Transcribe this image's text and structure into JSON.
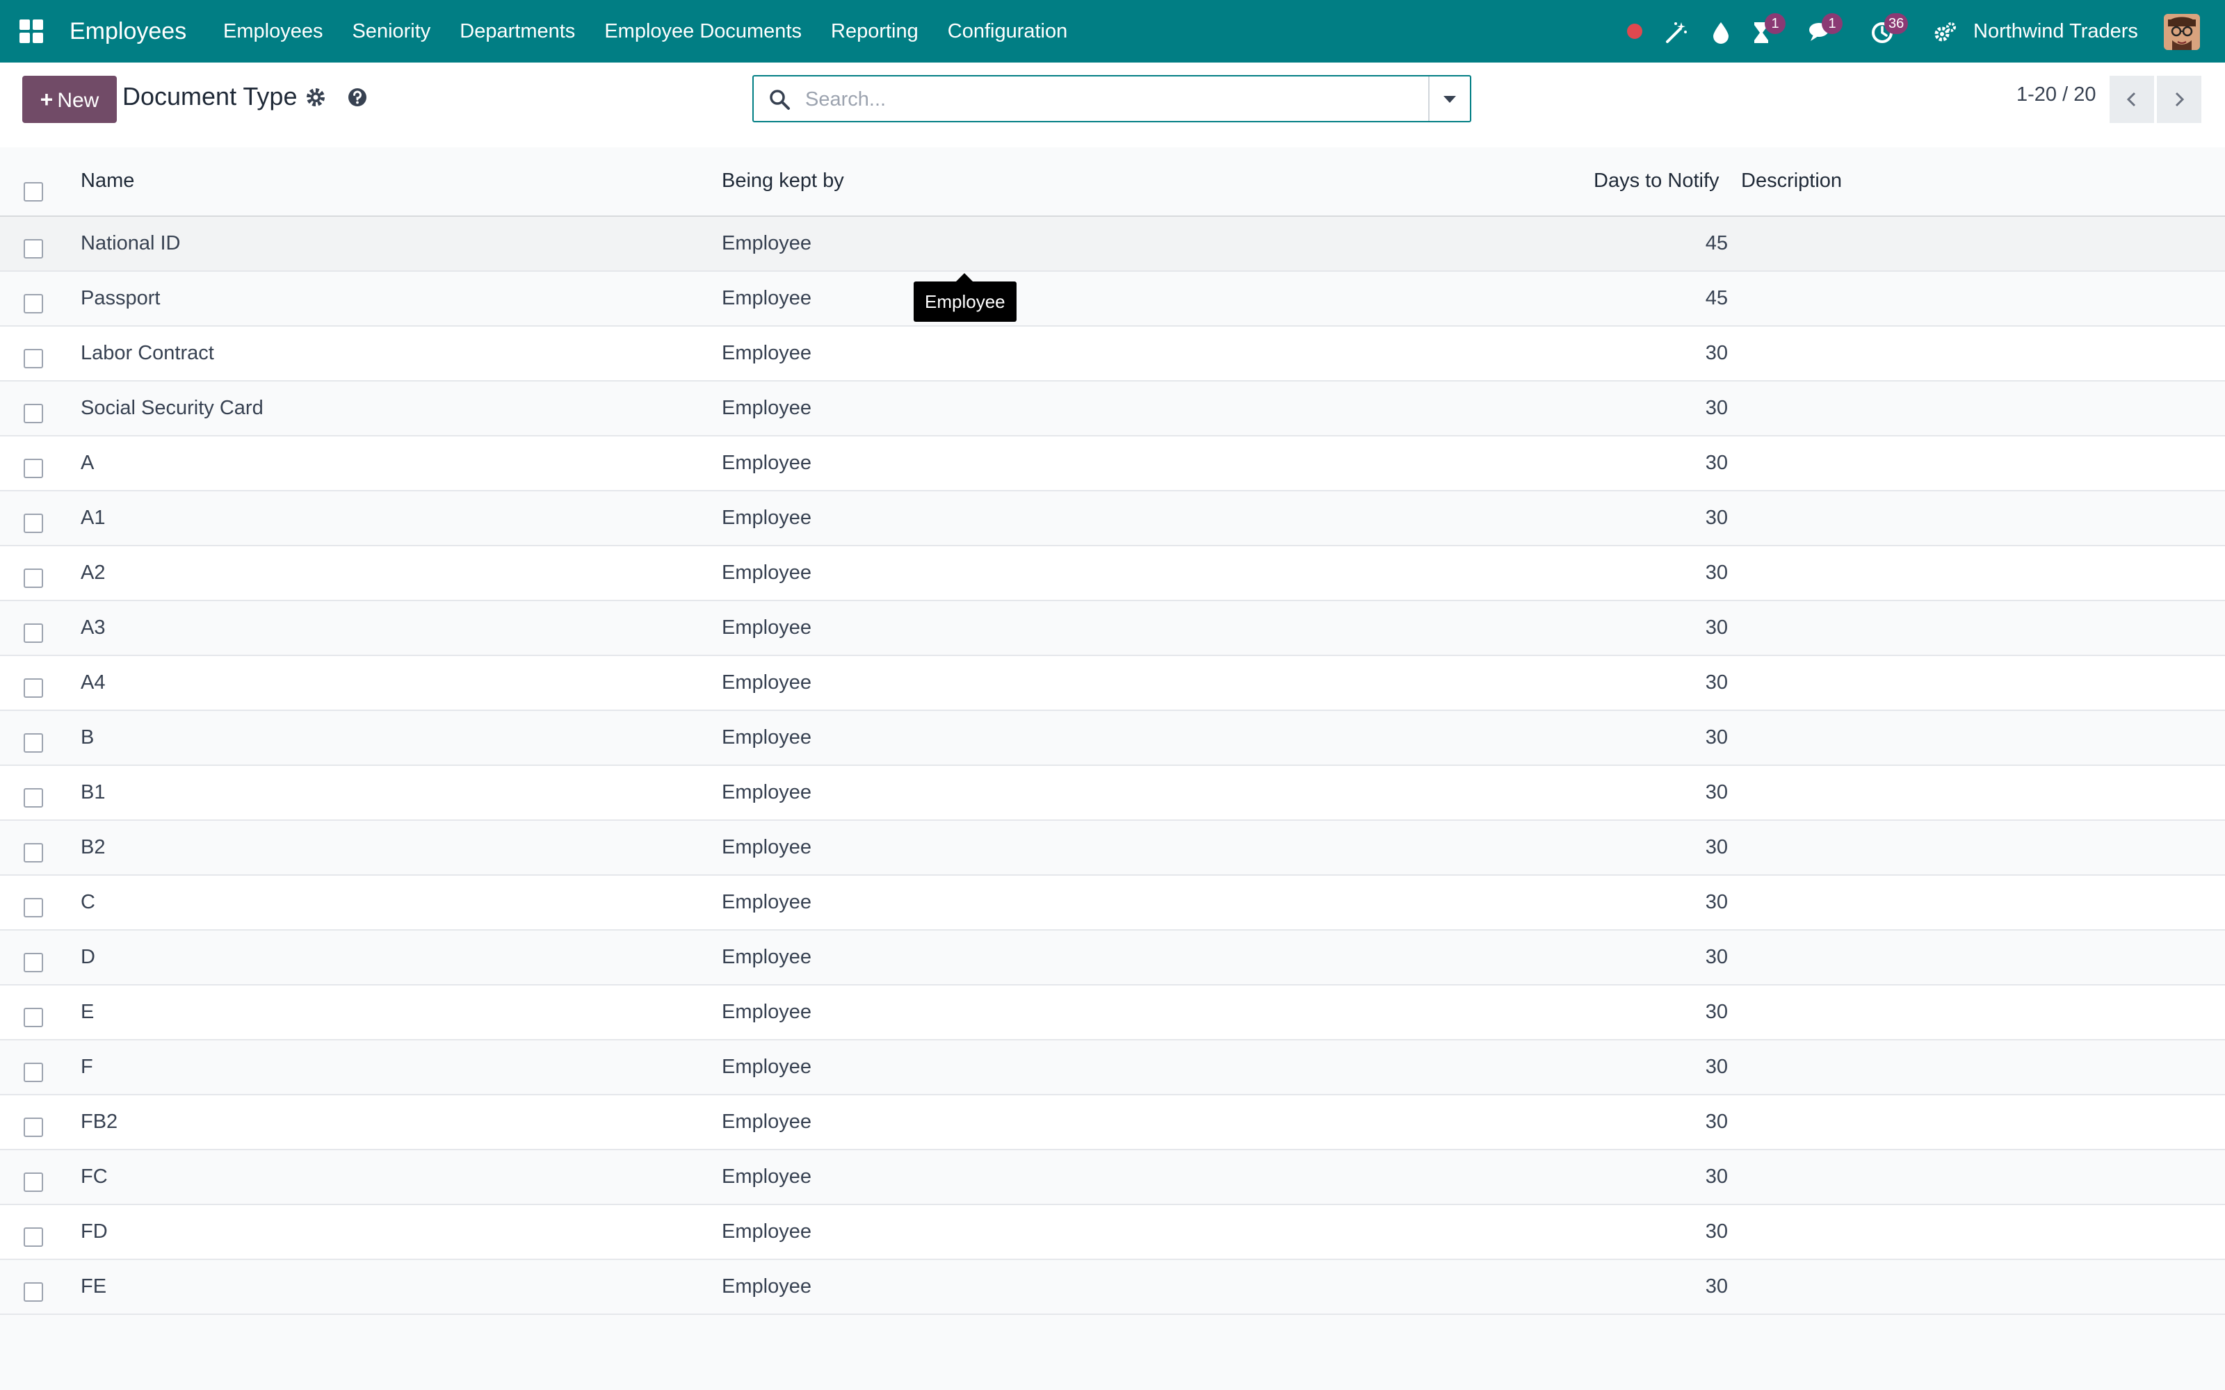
{
  "navbar": {
    "app_name": "Employees",
    "menu": [
      "Employees",
      "Seniority",
      "Departments",
      "Employee Documents",
      "Reporting",
      "Configuration"
    ],
    "systray": {
      "recording_icon": "red-dot-icon",
      "debug_icon": "magic-wand-icon",
      "drop_icon": "droplet-icon",
      "activity_badge": "1",
      "messages_badge": "1",
      "clock_badge": "36",
      "settings_icon": "gears-icon"
    },
    "company": "Northwind Traders"
  },
  "control_panel": {
    "new_label": "New",
    "title": "Document Type",
    "search_placeholder": "Search...",
    "pager": "1-20 / 20"
  },
  "table": {
    "columns": [
      "Name",
      "Being kept by",
      "Days to Notify",
      "Description"
    ],
    "rows": [
      {
        "name": "National ID",
        "kept_by": "Employee",
        "days": "45",
        "description": ""
      },
      {
        "name": "Passport",
        "kept_by": "Employee",
        "days": "45",
        "description": ""
      },
      {
        "name": "Labor Contract",
        "kept_by": "Employee",
        "days": "30",
        "description": ""
      },
      {
        "name": "Social Security Card",
        "kept_by": "Employee",
        "days": "30",
        "description": ""
      },
      {
        "name": "A",
        "kept_by": "Employee",
        "days": "30",
        "description": ""
      },
      {
        "name": "A1",
        "kept_by": "Employee",
        "days": "30",
        "description": ""
      },
      {
        "name": "A2",
        "kept_by": "Employee",
        "days": "30",
        "description": ""
      },
      {
        "name": "A3",
        "kept_by": "Employee",
        "days": "30",
        "description": ""
      },
      {
        "name": "A4",
        "kept_by": "Employee",
        "days": "30",
        "description": ""
      },
      {
        "name": "B",
        "kept_by": "Employee",
        "days": "30",
        "description": ""
      },
      {
        "name": "B1",
        "kept_by": "Employee",
        "days": "30",
        "description": ""
      },
      {
        "name": "B2",
        "kept_by": "Employee",
        "days": "30",
        "description": ""
      },
      {
        "name": "C",
        "kept_by": "Employee",
        "days": "30",
        "description": ""
      },
      {
        "name": "D",
        "kept_by": "Employee",
        "days": "30",
        "description": ""
      },
      {
        "name": "E",
        "kept_by": "Employee",
        "days": "30",
        "description": ""
      },
      {
        "name": "F",
        "kept_by": "Employee",
        "days": "30",
        "description": ""
      },
      {
        "name": "FB2",
        "kept_by": "Employee",
        "days": "30",
        "description": ""
      },
      {
        "name": "FC",
        "kept_by": "Employee",
        "days": "30",
        "description": ""
      },
      {
        "name": "FD",
        "kept_by": "Employee",
        "days": "30",
        "description": ""
      },
      {
        "name": "FE",
        "kept_by": "Employee",
        "days": "30",
        "description": ""
      }
    ]
  },
  "tooltip": {
    "text": "Employee"
  },
  "colors": {
    "navbar": "#017e84",
    "primary_button": "#714b67",
    "badge": "#8b3a74",
    "recording_dot": "#e0484f"
  }
}
